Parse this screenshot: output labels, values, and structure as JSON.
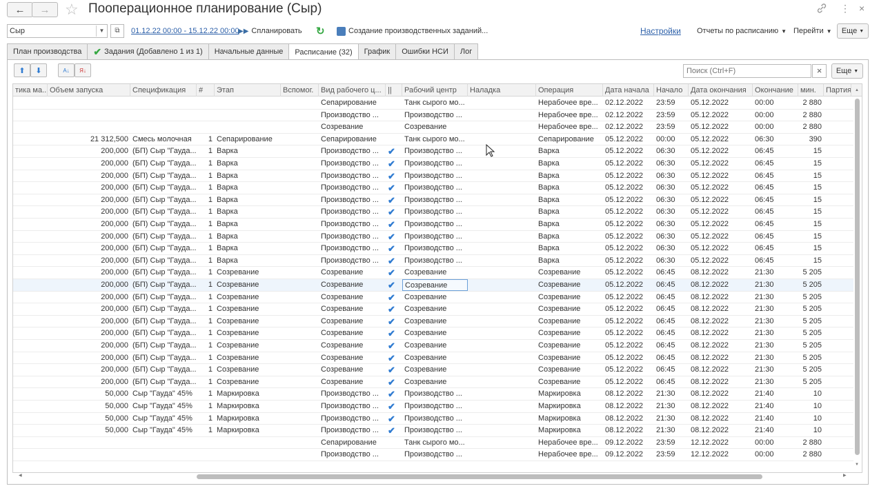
{
  "window": {
    "title": "Пооперационное планирование (Сыр)",
    "back_icon": "←",
    "forward_icon": "→",
    "star_icon": "☆",
    "link_icon": "🔗",
    "more_icon": "⋮",
    "close_icon": "×"
  },
  "toolbar": {
    "product_value": "Сыр",
    "period": "01.12.22 00:00 - 15.12.22 00:00",
    "plan_label": "Спланировать",
    "create_tasks_label": "Создание производственных заданий...",
    "settings_label": "Настройки",
    "reports_label": "Отчеты по расписанию",
    "goto_label": "Перейти",
    "more_label": "Еще"
  },
  "tabs": [
    {
      "label": "План производства"
    },
    {
      "label": "Задания (Добавлено 1 из 1)"
    },
    {
      "label": "Начальные данные"
    },
    {
      "label": "Расписание (32)"
    },
    {
      "label": "График"
    },
    {
      "label": "Ошибки НСИ"
    },
    {
      "label": "Лог"
    }
  ],
  "grid_toolbar": {
    "search_placeholder": "Поиск (Ctrl+F)",
    "more_label": "Еще"
  },
  "columns": [
    "тика ма...",
    "Объем запуска",
    "Спецификация",
    "#",
    "Этап",
    "Вспомог.",
    "Вид рабочего ц...",
    "||",
    "Рабочий центр",
    "Наладка",
    "Операция",
    "Дата начала",
    "Начало",
    "Дата окончания",
    "Окончание",
    "мин.",
    "Партия"
  ],
  "rows": [
    [
      "",
      "",
      "",
      "",
      "",
      "",
      "Сепарирование",
      "",
      "Танк сырого мо...",
      "",
      "Нерабочее вре...",
      "02.12.2022",
      "23:59",
      "05.12.2022",
      "00:00",
      "2 880"
    ],
    [
      "",
      "",
      "",
      "",
      "",
      "",
      "Производство ...",
      "",
      "Производство ...",
      "",
      "Нерабочее вре...",
      "02.12.2022",
      "23:59",
      "05.12.2022",
      "00:00",
      "2 880"
    ],
    [
      "",
      "",
      "",
      "",
      "",
      "",
      "Созревание",
      "",
      "Созревание",
      "",
      "Нерабочее вре...",
      "02.12.2022",
      "23:59",
      "05.12.2022",
      "00:00",
      "2 880"
    ],
    [
      "",
      "21 312,500",
      "Смесь молочная",
      "1",
      "Сепарирование",
      "",
      "Сепарирование",
      "",
      "Танк сырого мо...",
      "",
      "Сепарирование",
      "05.12.2022",
      "00:00",
      "05.12.2022",
      "06:30",
      "390"
    ],
    [
      "",
      "200,000",
      "(БП) Сыр \"Гауда...",
      "1",
      "Варка",
      "",
      "Производство ...",
      "✔",
      "Производство ...",
      "",
      "Варка",
      "05.12.2022",
      "06:30",
      "05.12.2022",
      "06:45",
      "15"
    ],
    [
      "",
      "200,000",
      "(БП) Сыр \"Гауда...",
      "1",
      "Варка",
      "",
      "Производство ...",
      "✔",
      "Производство ...",
      "",
      "Варка",
      "05.12.2022",
      "06:30",
      "05.12.2022",
      "06:45",
      "15"
    ],
    [
      "",
      "200,000",
      "(БП) Сыр \"Гауда...",
      "1",
      "Варка",
      "",
      "Производство ...",
      "✔",
      "Производство ...",
      "",
      "Варка",
      "05.12.2022",
      "06:30",
      "05.12.2022",
      "06:45",
      "15"
    ],
    [
      "",
      "200,000",
      "(БП) Сыр \"Гауда...",
      "1",
      "Варка",
      "",
      "Производство ...",
      "✔",
      "Производство ...",
      "",
      "Варка",
      "05.12.2022",
      "06:30",
      "05.12.2022",
      "06:45",
      "15"
    ],
    [
      "",
      "200,000",
      "(БП) Сыр \"Гауда...",
      "1",
      "Варка",
      "",
      "Производство ...",
      "✔",
      "Производство ...",
      "",
      "Варка",
      "05.12.2022",
      "06:30",
      "05.12.2022",
      "06:45",
      "15"
    ],
    [
      "",
      "200,000",
      "(БП) Сыр \"Гауда...",
      "1",
      "Варка",
      "",
      "Производство ...",
      "✔",
      "Производство ...",
      "",
      "Варка",
      "05.12.2022",
      "06:30",
      "05.12.2022",
      "06:45",
      "15"
    ],
    [
      "",
      "200,000",
      "(БП) Сыр \"Гауда...",
      "1",
      "Варка",
      "",
      "Производство ...",
      "✔",
      "Производство ...",
      "",
      "Варка",
      "05.12.2022",
      "06:30",
      "05.12.2022",
      "06:45",
      "15"
    ],
    [
      "",
      "200,000",
      "(БП) Сыр \"Гауда...",
      "1",
      "Варка",
      "",
      "Производство ...",
      "✔",
      "Производство ...",
      "",
      "Варка",
      "05.12.2022",
      "06:30",
      "05.12.2022",
      "06:45",
      "15"
    ],
    [
      "",
      "200,000",
      "(БП) Сыр \"Гауда...",
      "1",
      "Варка",
      "",
      "Производство ...",
      "✔",
      "Производство ...",
      "",
      "Варка",
      "05.12.2022",
      "06:30",
      "05.12.2022",
      "06:45",
      "15"
    ],
    [
      "",
      "200,000",
      "(БП) Сыр \"Гауда...",
      "1",
      "Варка",
      "",
      "Производство ...",
      "✔",
      "Производство ...",
      "",
      "Варка",
      "05.12.2022",
      "06:30",
      "05.12.2022",
      "06:45",
      "15"
    ],
    [
      "",
      "200,000",
      "(БП) Сыр \"Гауда...",
      "1",
      "Созревание",
      "",
      "Созревание",
      "✔",
      "Созревание",
      "",
      "Созревание",
      "05.12.2022",
      "06:45",
      "08.12.2022",
      "21:30",
      "5 205"
    ],
    [
      "",
      "200,000",
      "(БП) Сыр \"Гауда...",
      "1",
      "Созревание",
      "",
      "Созревание",
      "✔",
      "Созревание",
      "",
      "Созревание",
      "05.12.2022",
      "06:45",
      "08.12.2022",
      "21:30",
      "5 205"
    ],
    [
      "",
      "200,000",
      "(БП) Сыр \"Гауда...",
      "1",
      "Созревание",
      "",
      "Созревание",
      "✔",
      "Созревание",
      "",
      "Созревание",
      "05.12.2022",
      "06:45",
      "08.12.2022",
      "21:30",
      "5 205"
    ],
    [
      "",
      "200,000",
      "(БП) Сыр \"Гауда...",
      "1",
      "Созревание",
      "",
      "Созревание",
      "✔",
      "Созревание",
      "",
      "Созревание",
      "05.12.2022",
      "06:45",
      "08.12.2022",
      "21:30",
      "5 205"
    ],
    [
      "",
      "200,000",
      "(БП) Сыр \"Гауда...",
      "1",
      "Созревание",
      "",
      "Созревание",
      "✔",
      "Созревание",
      "",
      "Созревание",
      "05.12.2022",
      "06:45",
      "08.12.2022",
      "21:30",
      "5 205"
    ],
    [
      "",
      "200,000",
      "(БП) Сыр \"Гауда...",
      "1",
      "Созревание",
      "",
      "Созревание",
      "✔",
      "Созревание",
      "",
      "Созревание",
      "05.12.2022",
      "06:45",
      "08.12.2022",
      "21:30",
      "5 205"
    ],
    [
      "",
      "200,000",
      "(БП) Сыр \"Гауда...",
      "1",
      "Созревание",
      "",
      "Созревание",
      "✔",
      "Созревание",
      "",
      "Созревание",
      "05.12.2022",
      "06:45",
      "08.12.2022",
      "21:30",
      "5 205"
    ],
    [
      "",
      "200,000",
      "(БП) Сыр \"Гауда...",
      "1",
      "Созревание",
      "",
      "Созревание",
      "✔",
      "Созревание",
      "",
      "Созревание",
      "05.12.2022",
      "06:45",
      "08.12.2022",
      "21:30",
      "5 205"
    ],
    [
      "",
      "200,000",
      "(БП) Сыр \"Гауда...",
      "1",
      "Созревание",
      "",
      "Созревание",
      "✔",
      "Созревание",
      "",
      "Созревание",
      "05.12.2022",
      "06:45",
      "08.12.2022",
      "21:30",
      "5 205"
    ],
    [
      "",
      "200,000",
      "(БП) Сыр \"Гауда...",
      "1",
      "Созревание",
      "",
      "Созревание",
      "✔",
      "Созревание",
      "",
      "Созревание",
      "05.12.2022",
      "06:45",
      "08.12.2022",
      "21:30",
      "5 205"
    ],
    [
      "",
      "50,000",
      "Сыр \"Гауда\" 45%",
      "1",
      "Маркировка",
      "",
      "Производство ...",
      "✔",
      "Производство ...",
      "",
      "Маркировка",
      "08.12.2022",
      "21:30",
      "08.12.2022",
      "21:40",
      "10"
    ],
    [
      "",
      "50,000",
      "Сыр \"Гауда\" 45%",
      "1",
      "Маркировка",
      "",
      "Производство ...",
      "✔",
      "Производство ...",
      "",
      "Маркировка",
      "08.12.2022",
      "21:30",
      "08.12.2022",
      "21:40",
      "10"
    ],
    [
      "",
      "50,000",
      "Сыр \"Гауда\" 45%",
      "1",
      "Маркировка",
      "",
      "Производство ...",
      "✔",
      "Производство ...",
      "",
      "Маркировка",
      "08.12.2022",
      "21:30",
      "08.12.2022",
      "21:40",
      "10"
    ],
    [
      "",
      "50,000",
      "Сыр \"Гауда\" 45%",
      "1",
      "Маркировка",
      "",
      "Производство ...",
      "✔",
      "Производство ...",
      "",
      "Маркировка",
      "08.12.2022",
      "21:30",
      "08.12.2022",
      "21:40",
      "10"
    ],
    [
      "",
      "",
      "",
      "",
      "",
      "",
      "Сепарирование",
      "",
      "Танк сырого мо...",
      "",
      "Нерабочее вре...",
      "09.12.2022",
      "23:59",
      "12.12.2022",
      "00:00",
      "2 880"
    ],
    [
      "",
      "",
      "",
      "",
      "",
      "",
      "Производство ...",
      "",
      "Производство ...",
      "",
      "Нерабочее вре...",
      "09.12.2022",
      "23:59",
      "12.12.2022",
      "00:00",
      "2 880"
    ]
  ]
}
